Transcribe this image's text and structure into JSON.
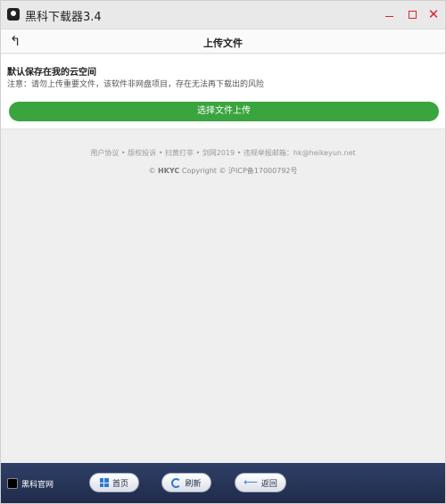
{
  "window": {
    "title": "黑科下载器3.4"
  },
  "header": {
    "title": "上传文件"
  },
  "panel": {
    "title": "默认保存在我的云空间",
    "note": "注意：请勿上传重要文件，该软件非网盘项目，存在无法再下载出的风险",
    "upload_button": "选择文件上传"
  },
  "footer": {
    "links": "用户协议 • 版权投诉 • 扫黄打非 • 剑网2019 • 违规举报邮箱：hk@heikeyun.net",
    "copyright_brand": "HKYC",
    "copyright_text": "Copyright © 沪ICP备17000792号"
  },
  "bottombar": {
    "site_label": "黑科官网",
    "home_label": "首页",
    "refresh_label": "刷新",
    "back_label": "返回"
  },
  "colors": {
    "accent_green": "#3aa43f",
    "bottom_bar": "#2f3f66"
  }
}
